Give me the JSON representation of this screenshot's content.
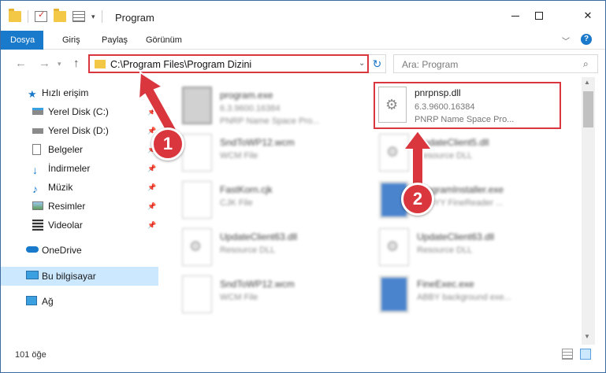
{
  "window": {
    "title": "Program"
  },
  "ribbon": {
    "tabs": [
      "Dosya",
      "Giriş",
      "Paylaş",
      "Görünüm"
    ],
    "active_tab": "Dosya"
  },
  "address": {
    "path": "C:\\Program Files\\Program Dizini"
  },
  "search": {
    "placeholder": "Ara: Program"
  },
  "sidebar": {
    "items": [
      {
        "label": "Hızlı erişim",
        "icon": "star-icon"
      },
      {
        "label": "Yerel Disk (C:)",
        "icon": "drive-icon"
      },
      {
        "label": "Yerel Disk (D:)",
        "icon": "drive-icon"
      },
      {
        "label": "Belgeler",
        "icon": "documents-icon"
      },
      {
        "label": "İndirmeler",
        "icon": "download-icon"
      },
      {
        "label": "Müzik",
        "icon": "music-icon"
      },
      {
        "label": "Resimler",
        "icon": "pictures-icon"
      },
      {
        "label": "Videolar",
        "icon": "video-icon"
      },
      {
        "label": "OneDrive",
        "icon": "cloud-icon"
      },
      {
        "label": "Bu bilgisayar",
        "icon": "computer-icon"
      },
      {
        "label": "Ağ",
        "icon": "network-icon"
      }
    ],
    "selected": "Bu bilgisayar"
  },
  "files": {
    "left": [
      {
        "name": "program.exe",
        "sub1": "6.3.9600.16384",
        "sub2": "PNRP Name Space Pro...",
        "type": "exe"
      },
      {
        "name": "SndToWP12.wcm",
        "sub1": "WCM File",
        "sub2": "",
        "type": "doc"
      },
      {
        "name": "FastKorn.cjk",
        "sub1": "CJK File",
        "sub2": "",
        "type": "doc"
      },
      {
        "name": "UpdateClient63.dll",
        "sub1": "Resource DLL",
        "sub2": "",
        "type": "dll"
      },
      {
        "name": "SndToWP12.wcm",
        "sub1": "WCM File",
        "sub2": "",
        "type": "doc"
      }
    ],
    "right": [
      {
        "name": "pnrpnsp.dll",
        "sub1": "6.3.9600.16384",
        "sub2": "PNRP Name Space Pro...",
        "type": "dll"
      },
      {
        "name": "UpdateClient5.dll",
        "sub1": "Resource DLL",
        "sub2": "",
        "type": "dll"
      },
      {
        "name": "ProgramInstaller.exe",
        "sub1": "ABBYY FineReader ...",
        "sub2": "",
        "type": "exe"
      },
      {
        "name": "UpdateClient63.dll",
        "sub1": "Resource DLL",
        "sub2": "",
        "type": "dll"
      },
      {
        "name": "FineExec.exe",
        "sub1": "ABBY background exe...",
        "sub2": "",
        "type": "exe"
      }
    ]
  },
  "status": {
    "count": "101 öğe"
  },
  "callouts": [
    "1",
    "2"
  ],
  "colors": {
    "accent": "#1979ca",
    "highlight": "#d9363e",
    "selection": "#cce8ff"
  }
}
